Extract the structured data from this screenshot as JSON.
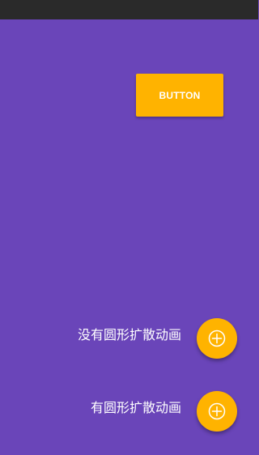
{
  "colors": {
    "background": "#6a45b9",
    "status_bar": "#2a2a2a",
    "accent": "#ffb300",
    "text": "#ffffff"
  },
  "main": {
    "button_label": "BUTTON",
    "fab_items": [
      {
        "label": "没有圆形扩散动画",
        "icon": "add-circle-icon"
      },
      {
        "label": "有圆形扩散动画",
        "icon": "add-circle-icon"
      }
    ]
  }
}
